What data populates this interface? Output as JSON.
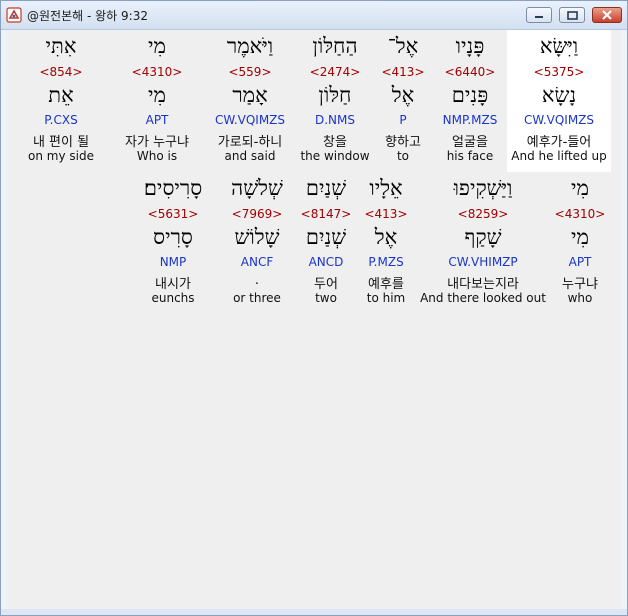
{
  "window": {
    "title": "@원전본해 - 왕하 9:32"
  },
  "words": [
    {
      "heb": "אִתִּי",
      "strong": "<854>",
      "lemma": "אֵת",
      "morph": "P.CXS",
      "kor": "내 편이 될",
      "eng": "on my side"
    },
    {
      "heb": "מִי",
      "strong": "<4310>",
      "lemma": "מִי",
      "morph": "APT",
      "kor": "자가 누구냐",
      "eng": "Who is"
    },
    {
      "heb": "וַיֹּאמֶר",
      "strong": "<559>",
      "lemma": "אָמַר",
      "morph": "CW.VQIMZS",
      "kor": "가로되-하니",
      "eng": "and said"
    },
    {
      "heb": "הַחַלּוֹן",
      "strong": "<2474>",
      "lemma": "חַלּוֹן",
      "morph": "D.NMS",
      "kor": "창을",
      "eng": "the window"
    },
    {
      "heb": "אֶל־",
      "strong": "<413>",
      "lemma": "אֶל",
      "morph": "P",
      "kor": "향하고",
      "eng": "to"
    },
    {
      "heb": "פָּנָיו",
      "strong": "<6440>",
      "lemma": "פָּנִים",
      "morph": "NMP.MZS",
      "kor": "얼굴을",
      "eng": "his face"
    },
    {
      "heb": "וַיִּשָּׂא",
      "strong": "<5375>",
      "lemma": "נָשָׂא",
      "morph": "CW.VQIMZS",
      "kor": "예후가-들어",
      "eng": "And he lifted up"
    },
    {
      "heb": "סָרִיסִים׃",
      "strong": "<5631>",
      "lemma": "סָרִיס",
      "morph": "NMP",
      "kor": "내시가",
      "eng": "eunchs"
    },
    {
      "heb": "שְׁלֹשָׁה",
      "strong": "<7969>",
      "lemma": "שָׁלוֹשׁ",
      "morph": "ANCF",
      "kor": ".",
      "eng": "or three"
    },
    {
      "heb": "שְׁנַיִם",
      "strong": "<8147>",
      "lemma": "שְׁנַיִם",
      "morph": "ANCD",
      "kor": "두어",
      "eng": "two"
    },
    {
      "heb": "אֵלָיו",
      "strong": "<413>",
      "lemma": "אֶל",
      "morph": "P.MZS",
      "kor": "예후를",
      "eng": "to him"
    },
    {
      "heb": "וַיַּשְׁקִיפוּ",
      "strong": "<8259>",
      "lemma": "שָׁקַף",
      "morph": "CW.VHIMZP",
      "kor": "내다보는지라",
      "eng": "And there looked out"
    },
    {
      "heb": "מִי",
      "strong": "<4310>",
      "lemma": "מִי",
      "morph": "APT",
      "kor": "누구냐",
      "eng": "who"
    }
  ]
}
